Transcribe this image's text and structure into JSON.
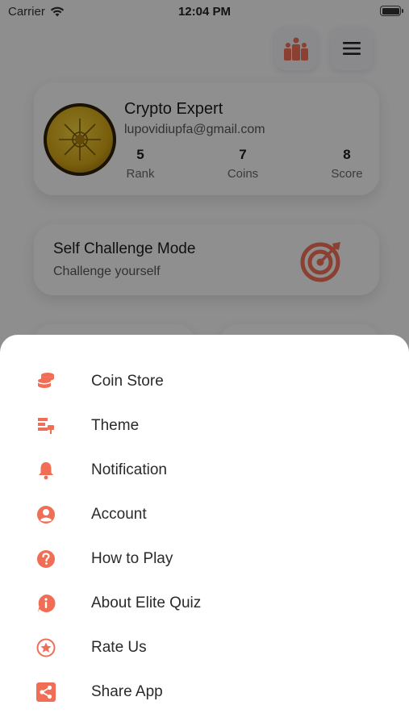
{
  "status_bar": {
    "carrier": "Carrier",
    "time": "12:04 PM"
  },
  "profile": {
    "name": "Crypto Expert",
    "email": "lupovidiupfa@gmail.com",
    "stats": [
      {
        "value": "5",
        "label": "Rank"
      },
      {
        "value": "7",
        "label": "Coins"
      },
      {
        "value": "8",
        "label": "Score"
      }
    ]
  },
  "challenge": {
    "title": "Self Challenge Mode",
    "subtitle": "Challenge yourself"
  },
  "menu": {
    "items": [
      {
        "label": "Coin Store",
        "icon": "coins-icon"
      },
      {
        "label": "Theme",
        "icon": "theme-icon"
      },
      {
        "label": "Notification",
        "icon": "bell-icon"
      },
      {
        "label": "Account",
        "icon": "account-icon"
      },
      {
        "label": "How to Play",
        "icon": "help-icon"
      },
      {
        "label": "About Elite Quiz",
        "icon": "info-icon"
      },
      {
        "label": "Rate Us",
        "icon": "star-icon"
      },
      {
        "label": "Share App",
        "icon": "share-icon"
      }
    ]
  },
  "colors": {
    "accent": "#f06e55",
    "background": "#f4f4f6",
    "sheet": "#ffffff"
  }
}
